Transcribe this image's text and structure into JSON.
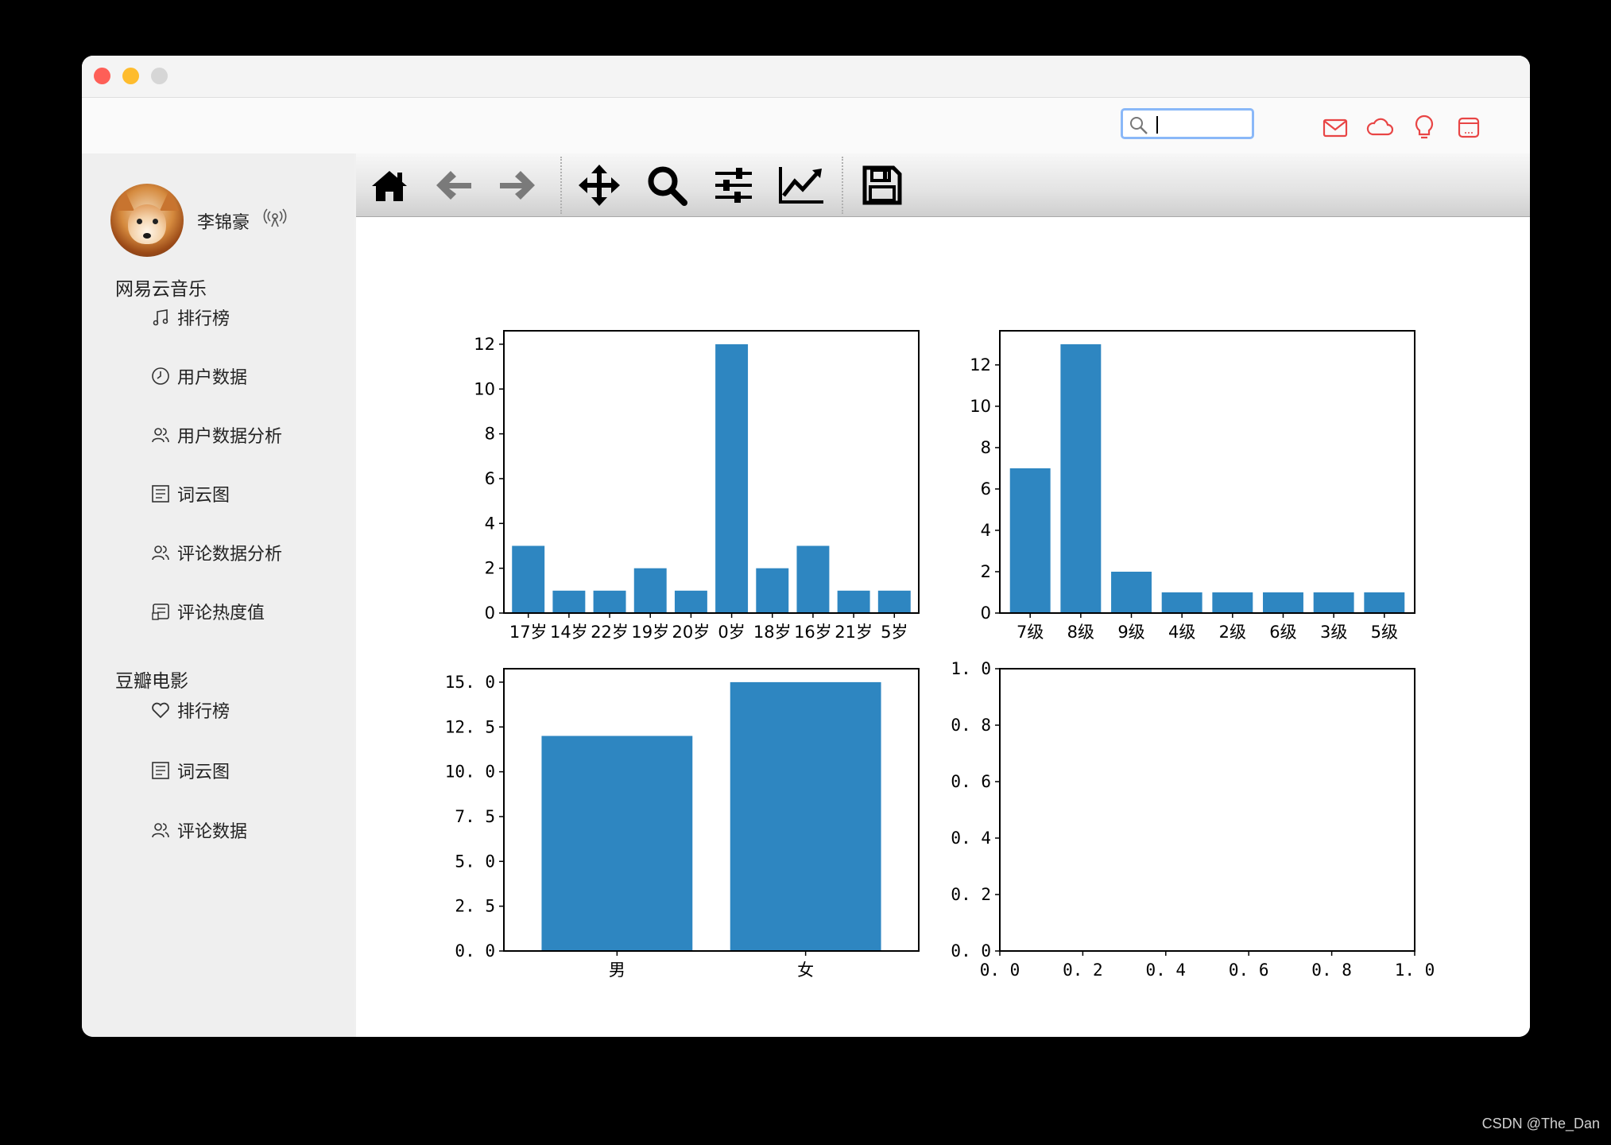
{
  "header": {
    "search": {
      "value": "",
      "placeholder": ""
    },
    "icons": [
      "mail-icon",
      "cloud-icon",
      "lightbulb-icon",
      "message-icon"
    ],
    "accent": "#e84545"
  },
  "user": {
    "name": "李锦豪",
    "status_icon": "broadcast-icon"
  },
  "sidebar": {
    "sections": [
      {
        "title": "网易云音乐",
        "items": [
          {
            "label": "排行榜",
            "icon": "music-note-icon"
          },
          {
            "label": "用户数据",
            "icon": "clock-icon"
          },
          {
            "label": "用户数据分析",
            "icon": "users-icon"
          },
          {
            "label": "词云图",
            "icon": "wordcloud-icon"
          },
          {
            "label": "评论数据分析",
            "icon": "users-icon"
          },
          {
            "label": "评论热度值",
            "icon": "list-icon"
          }
        ]
      },
      {
        "title": "豆瓣电影",
        "items": [
          {
            "label": "排行榜",
            "icon": "heart-icon"
          },
          {
            "label": "词云图",
            "icon": "wordcloud-icon"
          },
          {
            "label": "评论数据",
            "icon": "users-icon"
          }
        ]
      }
    ]
  },
  "toolbar": {
    "buttons": [
      "home-icon",
      "back-arrow-icon",
      "forward-arrow-icon",
      "pan-icon",
      "zoom-icon",
      "configure-subplots-icon",
      "edit-axis-icon",
      "save-icon"
    ]
  },
  "watermark": "CSDN @The_Dan",
  "chart_data": [
    {
      "type": "bar",
      "categories": [
        "17岁",
        "14岁",
        "22岁",
        "19岁",
        "20岁",
        "0岁",
        "18岁",
        "16岁",
        "21岁",
        "5岁"
      ],
      "values": [
        3,
        1,
        1,
        2,
        1,
        12,
        2,
        3,
        1,
        1
      ],
      "yticks": [
        "0",
        "2",
        "4",
        "6",
        "8",
        "10",
        "12"
      ],
      "ylim": [
        0,
        12.6
      ],
      "color": "#2e86c1"
    },
    {
      "type": "bar",
      "categories": [
        "7级",
        "8级",
        "9级",
        "4级",
        "2级",
        "6级",
        "3级",
        "5级"
      ],
      "values": [
        7,
        13,
        2,
        1,
        1,
        1,
        1,
        1
      ],
      "yticks": [
        "0",
        "2",
        "4",
        "6",
        "8",
        "10",
        "12"
      ],
      "ylim": [
        0,
        13.65
      ],
      "color": "#2e86c1"
    },
    {
      "type": "bar",
      "categories": [
        "男",
        "女"
      ],
      "values": [
        12,
        15
      ],
      "yticks": [
        "0. 0",
        "2. 5",
        "5. 0",
        "7. 5",
        "10. 0",
        "12. 5",
        "15. 0"
      ],
      "ylim": [
        0,
        15.75
      ],
      "color": "#2e86c1"
    },
    {
      "type": "bar",
      "categories": [],
      "values": [],
      "xticks": [
        "0. 0",
        "0. 2",
        "0. 4",
        "0. 6",
        "0. 8",
        "1. 0"
      ],
      "yticks": [
        "0. 0",
        "0. 2",
        "0. 4",
        "0. 6",
        "0. 8",
        "1. 0"
      ],
      "xlim": [
        0,
        1
      ],
      "ylim": [
        0,
        1
      ]
    }
  ]
}
